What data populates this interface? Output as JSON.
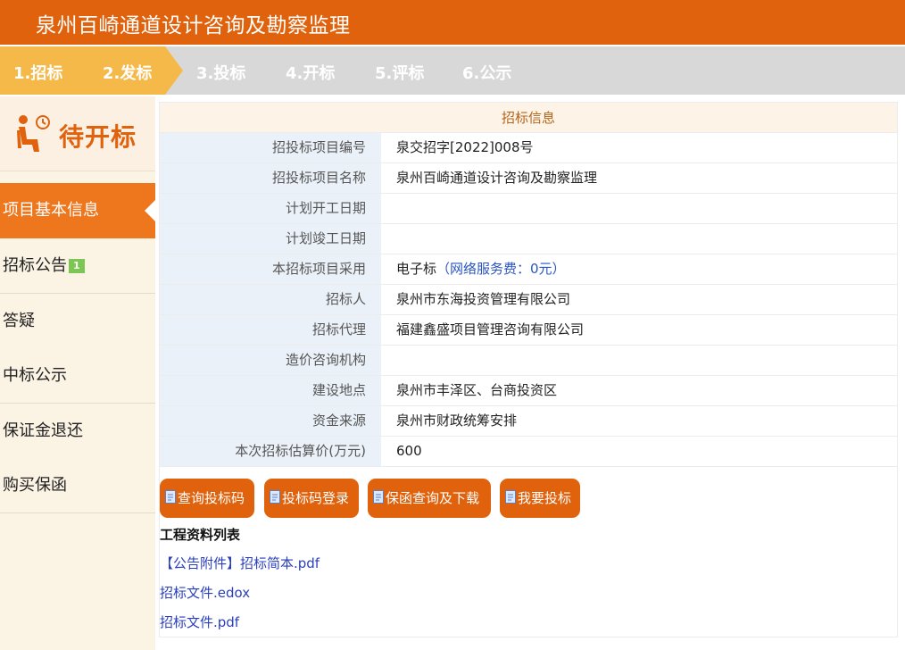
{
  "header": {
    "title": "泉州百崎通道设计咨询及勘察监理"
  },
  "steps": [
    "1.招标",
    "2.发标",
    "3.投标",
    "4.开标",
    "5.评标",
    "6.公示"
  ],
  "sidebar": {
    "status": "待开标",
    "items": [
      {
        "label": "项目基本信息"
      },
      {
        "label": "招标公告",
        "badge": "1"
      },
      {
        "label": "答疑"
      },
      {
        "label": "中标公示"
      },
      {
        "label": "保证金退还"
      },
      {
        "label": "购买保函"
      }
    ]
  },
  "info": {
    "title": "招标信息",
    "rows": [
      {
        "label": "招投标项目编号",
        "value": "泉交招字[2022]008号"
      },
      {
        "label": "招投标项目名称",
        "value": "泉州百崎通道设计咨询及勘察监理"
      },
      {
        "label": "计划开工日期",
        "value": ""
      },
      {
        "label": "计划竣工日期",
        "value": ""
      },
      {
        "label": "本招标项目采用",
        "value": "电子标",
        "extra": "（网络服务费：0元）"
      },
      {
        "label": "招标人",
        "value": "泉州市东海投资管理有限公司"
      },
      {
        "label": "招标代理",
        "value": "福建鑫盛项目管理咨询有限公司"
      },
      {
        "label": "造价咨询机构",
        "value": ""
      },
      {
        "label": "建设地点",
        "value": "泉州市丰泽区、台商投资区"
      },
      {
        "label": "资金来源",
        "value": "泉州市财政统筹安排"
      },
      {
        "label": "本次招标估算价(万元)",
        "value": "600"
      }
    ]
  },
  "buttons": [
    "查询投标码",
    "投标码登录",
    "保函查询及下载",
    "我要投标"
  ],
  "files": {
    "title": "工程资料列表",
    "items": [
      "【公告附件】招标简本.pdf",
      "招标文件.edox",
      "招标文件.pdf"
    ]
  }
}
